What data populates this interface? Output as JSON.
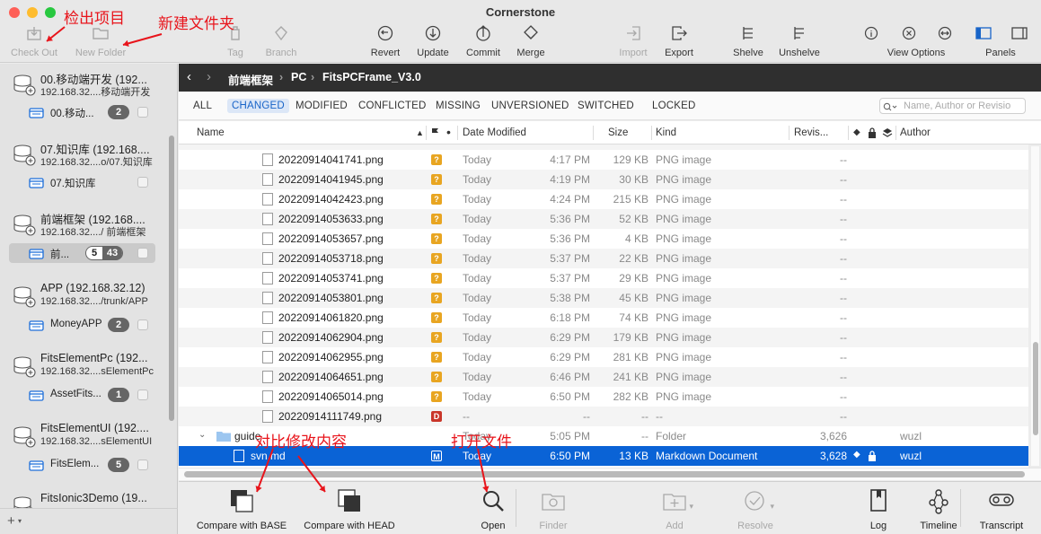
{
  "window": {
    "title": "Cornerstone"
  },
  "toolbar": {
    "items": [
      {
        "label": "Check Out",
        "icon": "checkout-icon",
        "enabled": false
      },
      {
        "label": "New Folder",
        "icon": "new-folder-icon",
        "enabled": false
      },
      {
        "label": "Tag",
        "icon": "tag-icon",
        "enabled": false
      },
      {
        "label": "Branch",
        "icon": "branch-icon",
        "enabled": false
      },
      {
        "label": "Revert",
        "icon": "revert-icon",
        "enabled": true
      },
      {
        "label": "Update",
        "icon": "update-icon",
        "enabled": true
      },
      {
        "label": "Commit",
        "icon": "commit-icon",
        "enabled": true
      },
      {
        "label": "Merge",
        "icon": "merge-icon",
        "enabled": true
      },
      {
        "label": "Import",
        "icon": "import-icon",
        "enabled": false
      },
      {
        "label": "Export",
        "icon": "export-icon",
        "enabled": true
      },
      {
        "label": "Shelve",
        "icon": "shelve-icon",
        "enabled": true
      },
      {
        "label": "Unshelve",
        "icon": "unshelve-icon",
        "enabled": true
      },
      {
        "label": "View Options",
        "icon": "view-options-icon",
        "enabled": true
      },
      {
        "label": "Panels",
        "icon": "panels-icon",
        "enabled": true
      }
    ]
  },
  "annotations": {
    "checkout": "检出项目",
    "new_folder": "新建文件夹",
    "compare": "对比修改内容",
    "open": "打开文件"
  },
  "sidebar": {
    "repos": [
      {
        "name": "00.移动端开发 (192...",
        "path": "192.168.32....移动端开发",
        "wc_name": "00.移动...",
        "badge": "2",
        "badge2": ""
      },
      {
        "name": "07.知识库 (192.168....",
        "path": "192.168.32....o/07.知识库",
        "wc_name": "07.知识库",
        "badge": "",
        "badge2": ""
      },
      {
        "name": "前端框架 (192.168....",
        "path": "192.168.32..../ 前端框架",
        "wc_name": "前...",
        "badge": "5",
        "badge2": "43"
      },
      {
        "name": "APP (192.168.32.12)",
        "path": "192.168.32..../trunk/APP",
        "wc_name": "MoneyAPP",
        "badge": "2",
        "badge2": ""
      },
      {
        "name": "FitsElementPc (192...",
        "path": "192.168.32....sElementPc",
        "wc_name": "AssetFits...",
        "badge": "1",
        "badge2": ""
      },
      {
        "name": "FitsElementUI (192....",
        "path": "192.168.32....sElementUI",
        "wc_name": "FitsElem...",
        "badge": "5",
        "badge2": ""
      },
      {
        "name": "FitsIonic3Demo (19...",
        "path": "",
        "wc_name": "",
        "badge": "",
        "badge2": ""
      }
    ],
    "footer_add": "+"
  },
  "pathbar": {
    "crumbs": [
      "前端框架",
      "PC",
      "FitsPCFrame_V3.0"
    ]
  },
  "filters": {
    "items": [
      "ALL",
      "CHANGED",
      "MODIFIED",
      "CONFLICTED",
      "MISSING",
      "UNVERSIONED",
      "SWITCHED",
      "LOCKED"
    ],
    "active": "CHANGED",
    "search_placeholder": "Name, Author or Revisio"
  },
  "columns": {
    "name": "Name",
    "date": "Date Modified",
    "size": "Size",
    "kind": "Kind",
    "revision": "Revis...",
    "author": "Author"
  },
  "files": [
    {
      "name": "20220914041741.png",
      "status": "?",
      "date": "Today",
      "time": "4:17 PM",
      "size": "129 KB",
      "kind": "PNG image",
      "rev": "--",
      "author": ""
    },
    {
      "name": "20220914041945.png",
      "status": "?",
      "date": "Today",
      "time": "4:19 PM",
      "size": "30 KB",
      "kind": "PNG image",
      "rev": "--",
      "author": ""
    },
    {
      "name": "20220914042423.png",
      "status": "?",
      "date": "Today",
      "time": "4:24 PM",
      "size": "215 KB",
      "kind": "PNG image",
      "rev": "--",
      "author": ""
    },
    {
      "name": "20220914053633.png",
      "status": "?",
      "date": "Today",
      "time": "5:36 PM",
      "size": "52 KB",
      "kind": "PNG image",
      "rev": "--",
      "author": ""
    },
    {
      "name": "20220914053657.png",
      "status": "?",
      "date": "Today",
      "time": "5:36 PM",
      "size": "4 KB",
      "kind": "PNG image",
      "rev": "--",
      "author": ""
    },
    {
      "name": "20220914053718.png",
      "status": "?",
      "date": "Today",
      "time": "5:37 PM",
      "size": "22 KB",
      "kind": "PNG image",
      "rev": "--",
      "author": ""
    },
    {
      "name": "20220914053741.png",
      "status": "?",
      "date": "Today",
      "time": "5:37 PM",
      "size": "29 KB",
      "kind": "PNG image",
      "rev": "--",
      "author": ""
    },
    {
      "name": "20220914053801.png",
      "status": "?",
      "date": "Today",
      "time": "5:38 PM",
      "size": "45 KB",
      "kind": "PNG image",
      "rev": "--",
      "author": ""
    },
    {
      "name": "20220914061820.png",
      "status": "?",
      "date": "Today",
      "time": "6:18 PM",
      "size": "74 KB",
      "kind": "PNG image",
      "rev": "--",
      "author": ""
    },
    {
      "name": "20220914062904.png",
      "status": "?",
      "date": "Today",
      "time": "6:29 PM",
      "size": "179 KB",
      "kind": "PNG image",
      "rev": "--",
      "author": ""
    },
    {
      "name": "20220914062955.png",
      "status": "?",
      "date": "Today",
      "time": "6:29 PM",
      "size": "281 KB",
      "kind": "PNG image",
      "rev": "--",
      "author": ""
    },
    {
      "name": "20220914064651.png",
      "status": "?",
      "date": "Today",
      "time": "6:46 PM",
      "size": "241 KB",
      "kind": "PNG image",
      "rev": "--",
      "author": ""
    },
    {
      "name": "20220914065014.png",
      "status": "?",
      "date": "Today",
      "time": "6:50 PM",
      "size": "282 KB",
      "kind": "PNG image",
      "rev": "--",
      "author": ""
    },
    {
      "name": "20220914111749.png",
      "status": "D",
      "date": "--",
      "time": "--",
      "size": "--",
      "kind": "--",
      "rev": "--",
      "author": ""
    },
    {
      "name": "guide",
      "status": "",
      "date": "Today",
      "time": "5:05 PM",
      "size": "--",
      "kind": "Folder",
      "rev": "3,626",
      "author": "wuzl"
    },
    {
      "name": "svn.md",
      "status": "M",
      "date": "Today",
      "time": "6:50 PM",
      "size": "13 KB",
      "kind": "Markdown Document",
      "rev": "3,628",
      "author": "wuzl"
    }
  ],
  "bottom": {
    "items": [
      {
        "label": "Compare with BASE",
        "icon": "compare-base-icon",
        "enabled": true
      },
      {
        "label": "Compare with HEAD",
        "icon": "compare-head-icon",
        "enabled": true
      },
      {
        "label": "Open",
        "icon": "open-search-icon",
        "enabled": true
      },
      {
        "label": "Finder",
        "icon": "finder-icon",
        "enabled": false
      },
      {
        "label": "Add",
        "icon": "add-icon",
        "enabled": false
      },
      {
        "label": "Resolve",
        "icon": "resolve-icon",
        "enabled": false
      },
      {
        "label": "Log",
        "icon": "log-icon",
        "enabled": true
      },
      {
        "label": "Timeline",
        "icon": "timeline-icon",
        "enabled": true
      },
      {
        "label": "Transcript",
        "icon": "transcript-icon",
        "enabled": true
      }
    ]
  },
  "colors": {
    "accent": "#0a63d6",
    "status_unversioned": "#e8a521",
    "status_deleted": "#c9362a",
    "annotation": "#e8141b"
  }
}
